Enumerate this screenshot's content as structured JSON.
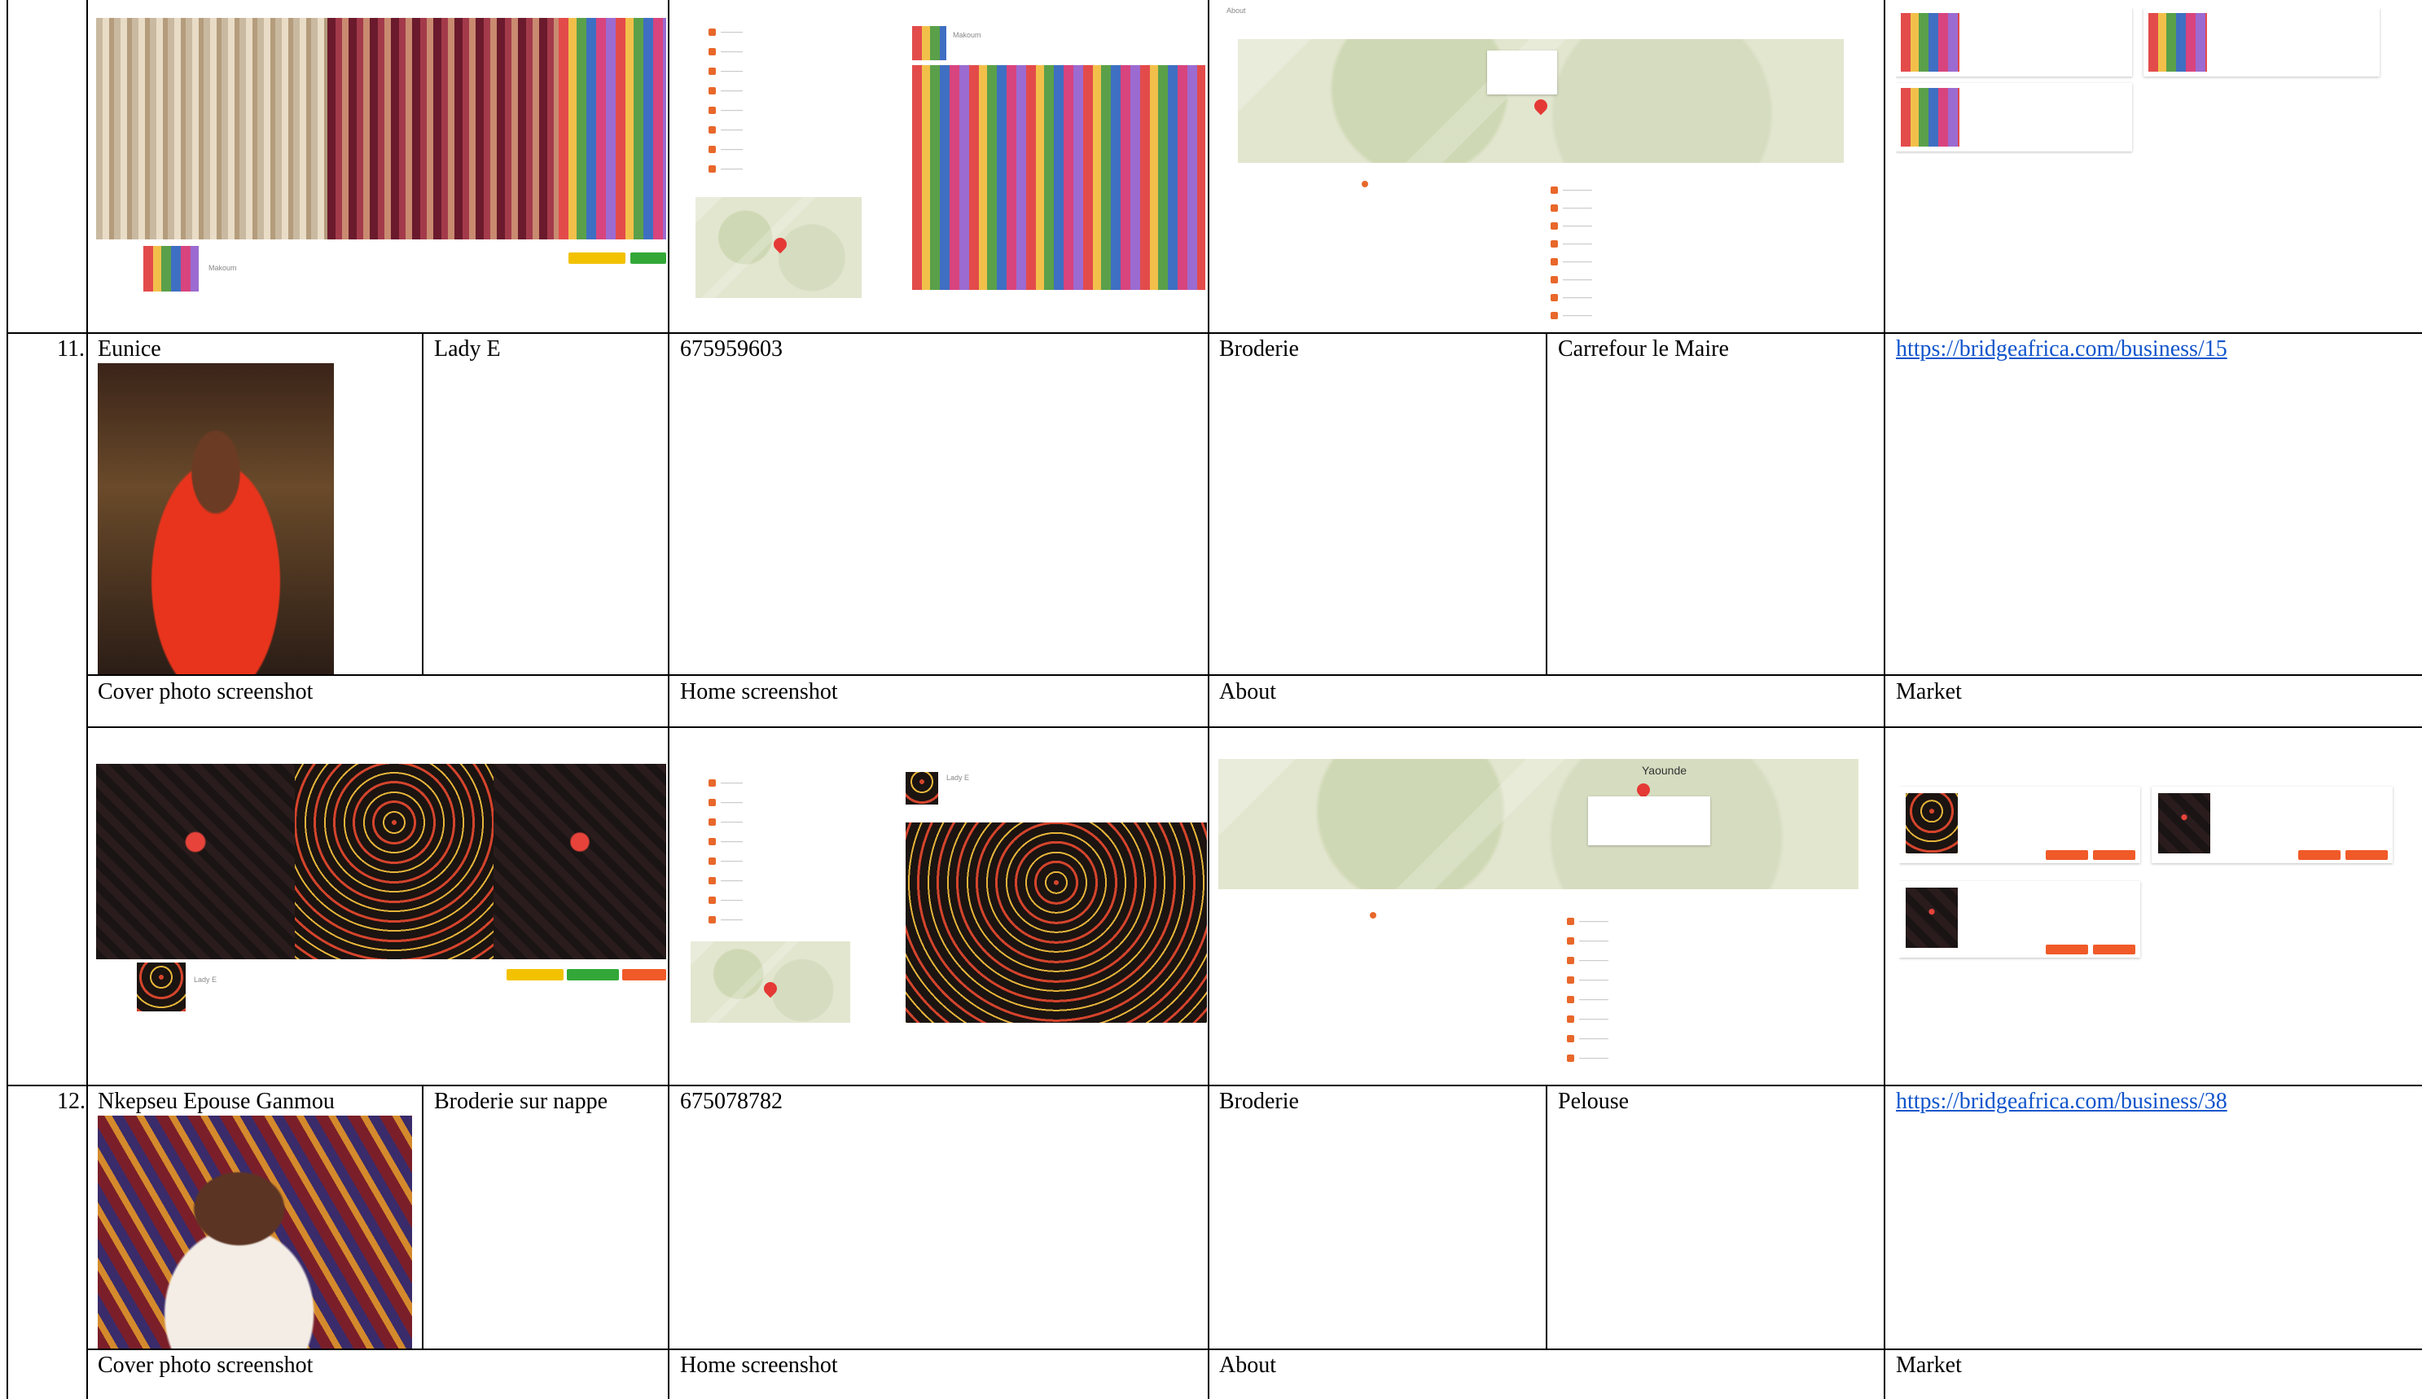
{
  "rows": [
    {
      "number": "11.",
      "name": "Eunice",
      "business": "Lady E",
      "phone": "675959603",
      "category": "Broderie",
      "location": "Carrefour le Maire",
      "link": "https://bridgeafrica.com/business/15",
      "labels": {
        "cover": "Cover photo screenshot",
        "home": "Home screenshot",
        "about": "About",
        "market": "Market"
      }
    },
    {
      "number": "12.",
      "name": "Nkepseu Epouse Ganmou",
      "business": "Broderie sur nappe",
      "phone": "675078782",
      "category": "Broderie",
      "location": "Pelouse",
      "link": "https://bridgeafrica.com/business/38",
      "labels": {
        "cover": "Cover photo screenshot",
        "home": "Home screenshot",
        "about": "About",
        "market": "Market"
      }
    }
  ],
  "map_city": "Yaounde",
  "colors": {
    "link": "#1155cc",
    "accent": "#f05a28",
    "yellow_button": "#f2c200",
    "green_button": "#33a838"
  }
}
